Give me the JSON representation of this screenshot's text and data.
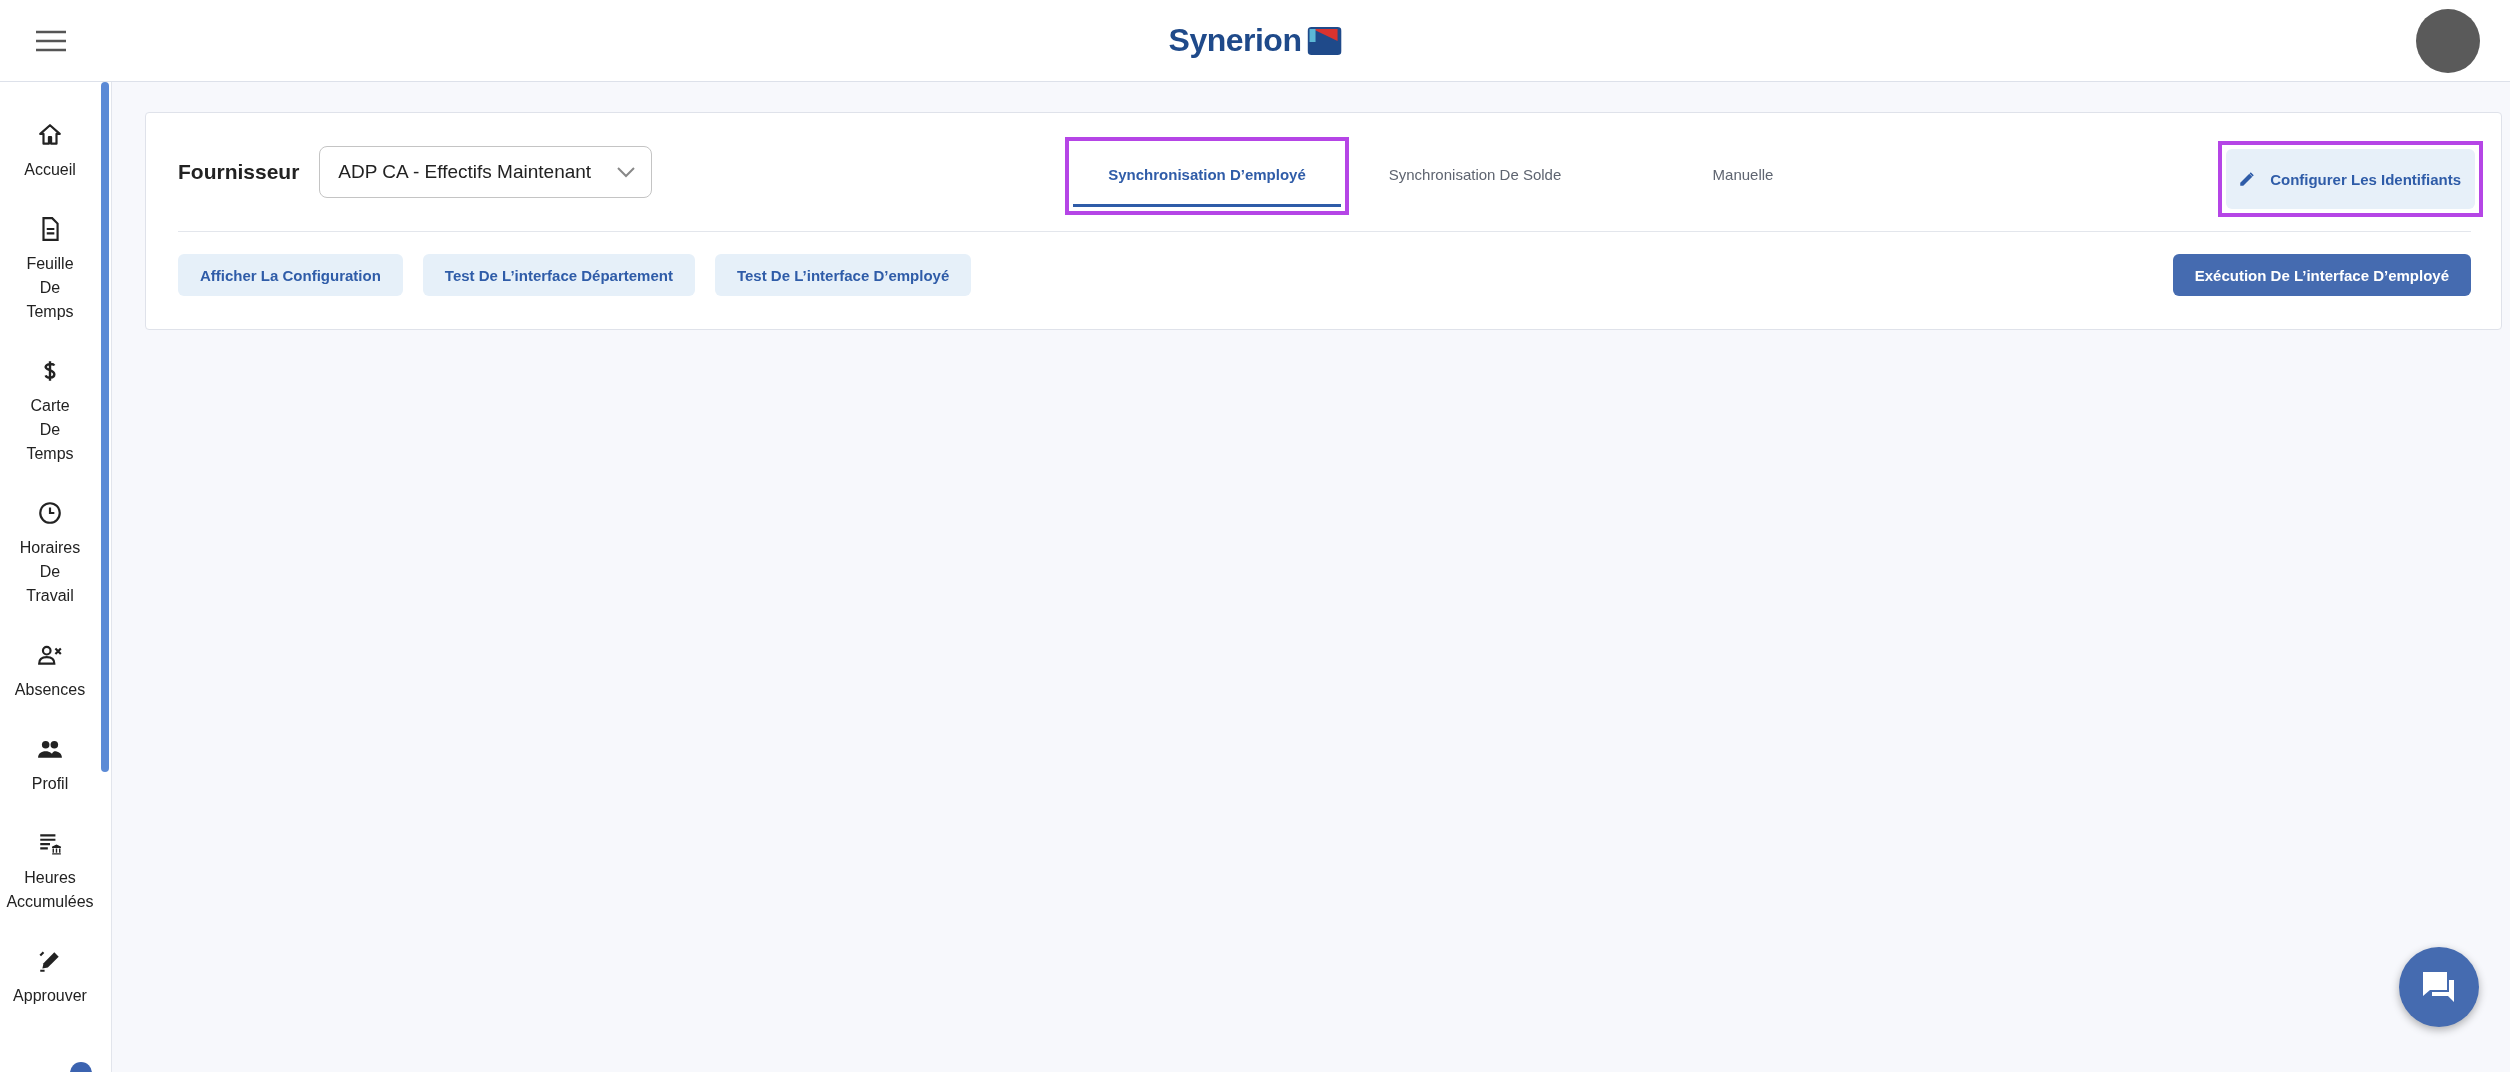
{
  "header": {
    "logo": "Synerion"
  },
  "sidebar": {
    "items": [
      {
        "kind": "home",
        "label": "Accueil"
      },
      {
        "kind": "document",
        "label": "Feuille De Temps"
      },
      {
        "kind": "dollar",
        "label": "Carte De Temps"
      },
      {
        "kind": "clock",
        "label": "Horaires De Travail"
      },
      {
        "kind": "person-x",
        "label": "Absences"
      },
      {
        "kind": "people",
        "label": "Profil"
      },
      {
        "kind": "list-bank",
        "label": "Heures Accumulées"
      },
      {
        "kind": "pen",
        "label": "Approuver"
      }
    ]
  },
  "provider": {
    "label": "Fournisseur",
    "value": "ADP CA - Effectifs Maintenant"
  },
  "tabs": [
    {
      "label": "Synchronisation D’employé",
      "selected": true,
      "highlighted": true
    },
    {
      "label": "Synchronisation De Solde",
      "selected": false,
      "highlighted": false
    },
    {
      "label": "Manuelle",
      "selected": false,
      "highlighted": false
    }
  ],
  "configure_button": {
    "label": "Configurer Les Identifiants",
    "highlighted": true
  },
  "actions": [
    {
      "label": "Afficher La Configuration",
      "kind": "secondary"
    },
    {
      "label": "Test De L’interface Département",
      "kind": "secondary"
    },
    {
      "label": "Test De L’interface D’employé",
      "kind": "secondary"
    },
    {
      "label": "Exécution De L’interface D’employé",
      "kind": "primary"
    }
  ]
}
